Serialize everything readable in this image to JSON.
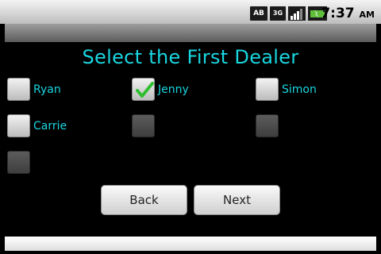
{
  "status_bar": {
    "icons": [
      "AB",
      "3G",
      "signal-icon",
      "battery-icon"
    ],
    "time": "7:37",
    "ampm": "AM"
  },
  "heading": "Select the First Dealer",
  "players": [
    {
      "label": "Ryan",
      "checked": false
    },
    {
      "label": "Jenny",
      "checked": true
    },
    {
      "label": "Simon",
      "checked": false
    },
    {
      "label": "Carrie",
      "checked": false
    },
    {
      "label": "",
      "checked": false,
      "enabled": false
    },
    {
      "label": "",
      "checked": false,
      "enabled": false
    },
    {
      "label": "",
      "checked": false,
      "enabled": false
    }
  ],
  "buttons": {
    "back": "Back",
    "next": "Next"
  },
  "colors": {
    "accent": "#19d6e0",
    "check": "#2fbf2f",
    "background": "#000000"
  }
}
